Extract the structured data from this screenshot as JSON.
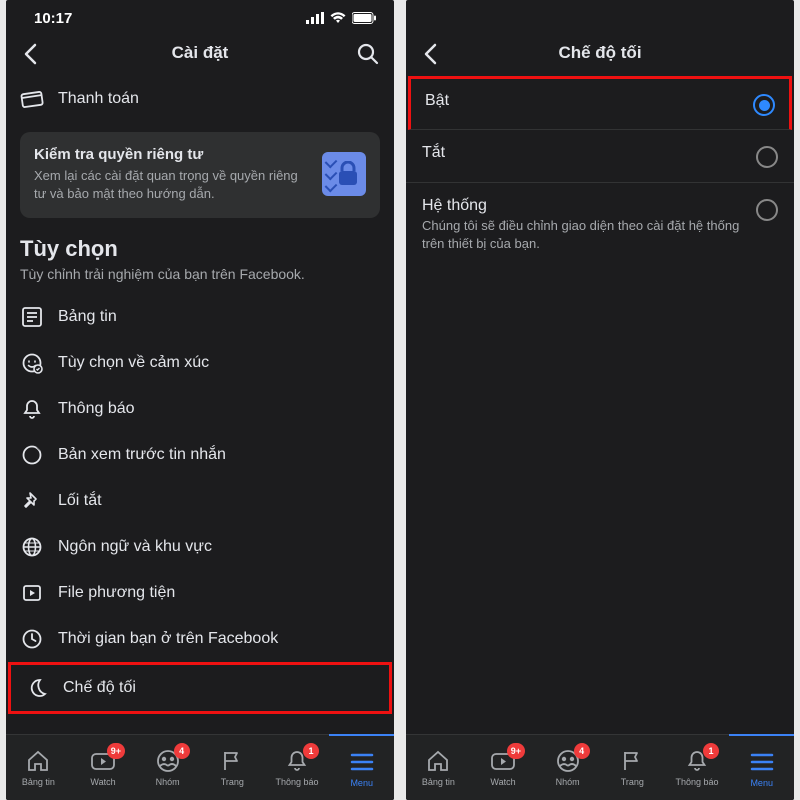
{
  "status_bar": {
    "time": "10:17"
  },
  "left": {
    "header": {
      "title": "Cài đặt"
    },
    "first_item": {
      "label": "Thanh toán"
    },
    "privacy_card": {
      "title": "Kiểm tra quyền riêng tư",
      "subtitle": "Xem lại các cài đặt quan trọng về quyền riêng tư và bảo mật theo hướng dẫn."
    },
    "section": {
      "title": "Tùy chọn",
      "subtitle": "Tùy chỉnh trải nghiệm của bạn trên Facebook."
    },
    "items": [
      {
        "label": "Bảng tin"
      },
      {
        "label": "Tùy chọn về cảm xúc"
      },
      {
        "label": "Thông báo"
      },
      {
        "label": "Bản xem trước tin nhắn"
      },
      {
        "label": "Lối tắt"
      },
      {
        "label": "Ngôn ngữ và khu vực"
      },
      {
        "label": "File phương tiện"
      },
      {
        "label": "Thời gian bạn ở trên Facebook"
      },
      {
        "label": "Chế độ tối"
      }
    ]
  },
  "right": {
    "header": {
      "title": "Chế độ tối"
    },
    "options": [
      {
        "label": "Bật",
        "sub": ""
      },
      {
        "label": "Tắt",
        "sub": ""
      },
      {
        "label": "Hệ thống",
        "sub": "Chúng tôi sẽ điều chỉnh giao diện theo cài đặt hệ thống trên thiết bị của bạn."
      }
    ]
  },
  "tabs": [
    {
      "label": "Bảng tin",
      "badge": ""
    },
    {
      "label": "Watch",
      "badge": "9+"
    },
    {
      "label": "Nhóm",
      "badge": "4"
    },
    {
      "label": "Trang",
      "badge": ""
    },
    {
      "label": "Thông báo",
      "badge": "1"
    },
    {
      "label": "Menu",
      "badge": ""
    }
  ]
}
